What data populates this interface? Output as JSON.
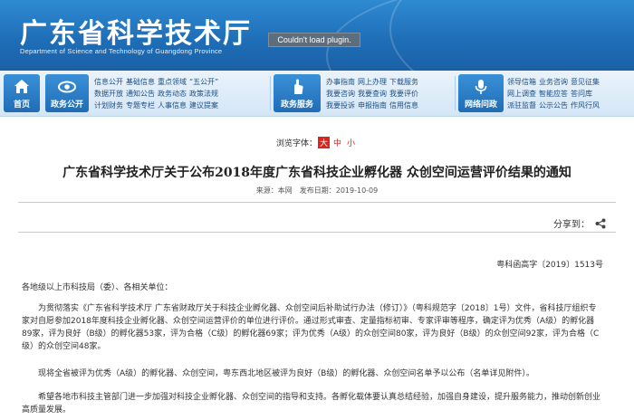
{
  "header": {
    "title": "广东省科学技术厅",
    "subtitle": "Department of Science and Technology of Guangdong Province",
    "plugin_message": "Couldn't load plugin."
  },
  "nav": {
    "home": "首页",
    "gov_open": {
      "label": "政务公开",
      "links": [
        [
          "信息公开",
          "基础信息",
          "重点领域",
          "“五公开”"
        ],
        [
          "数据开放",
          "通知公告",
          "政务动态",
          "政策法规"
        ],
        [
          "计划财务",
          "专题专栏",
          "人事信息",
          "建议提案"
        ]
      ]
    },
    "gov_service": {
      "label": "政务服务",
      "links": [
        [
          "办事指南",
          "网上办理",
          "下载服务"
        ],
        [
          "我要咨询",
          "我要查询",
          "我要评价"
        ],
        [
          "我要投诉",
          "申报指南",
          "信用信息"
        ]
      ]
    },
    "interaction": {
      "label": "网络问政",
      "links": [
        [
          "领导信箱",
          "业务咨询",
          "意见征集"
        ],
        [
          "网上调查",
          "智能应答",
          "答问库"
        ],
        [
          "派驻监督",
          "公示公告",
          "作风行风"
        ]
      ]
    }
  },
  "font_size": {
    "label": "浏览字体：",
    "big": "大",
    "mid": "中",
    "small": "小"
  },
  "article": {
    "title": "广东省科学技术厅关于公布2018年度广东省科技企业孵化器 众创空间运营评价结果的通知",
    "meta": "来源：本网　发布日期：2019-10-09",
    "share_label": "分享到：",
    "doc_number": "粤科函高字〔2019〕1513号",
    "salutation": "各地级以上市科技局（委）、各相关单位：",
    "para1": "为贯彻落实《广东省科学技术厅 广东省财政厅关于科技企业孵化器、众创空间后补助试行办法（修订）》（粤科规范字〔2018〕1号）文件，省科技厅组织专家对自愿参加2018年度科技企业孵化器、众创空间运营评价的单位进行评价。通过形式审查、定量指标初审、专家评审等程序，确定评为优秀（A级）的孵化器89家，评为良好（B级）的孵化器53家，评为合格（C级）的孵化器69家；评为优秀（A级）的众创空间80家，评为良好（B级）的众创空间92家，评为合格（C级）的众创空间48家。",
    "para2": "现将全省被评为优秀（A级）的孵化器、众创空间，粤东西北地区被评为良好（B级）的孵化器、众创空间名单予以公布（名单详见附件）。",
    "para3": "希望各地市科技主管部门进一步加强对科技企业孵化器、众创空间的指导和支持。各孵化载体要认真总结经验，加强自身建设，提升服务能力，推动创新创业高质量发展。"
  }
}
